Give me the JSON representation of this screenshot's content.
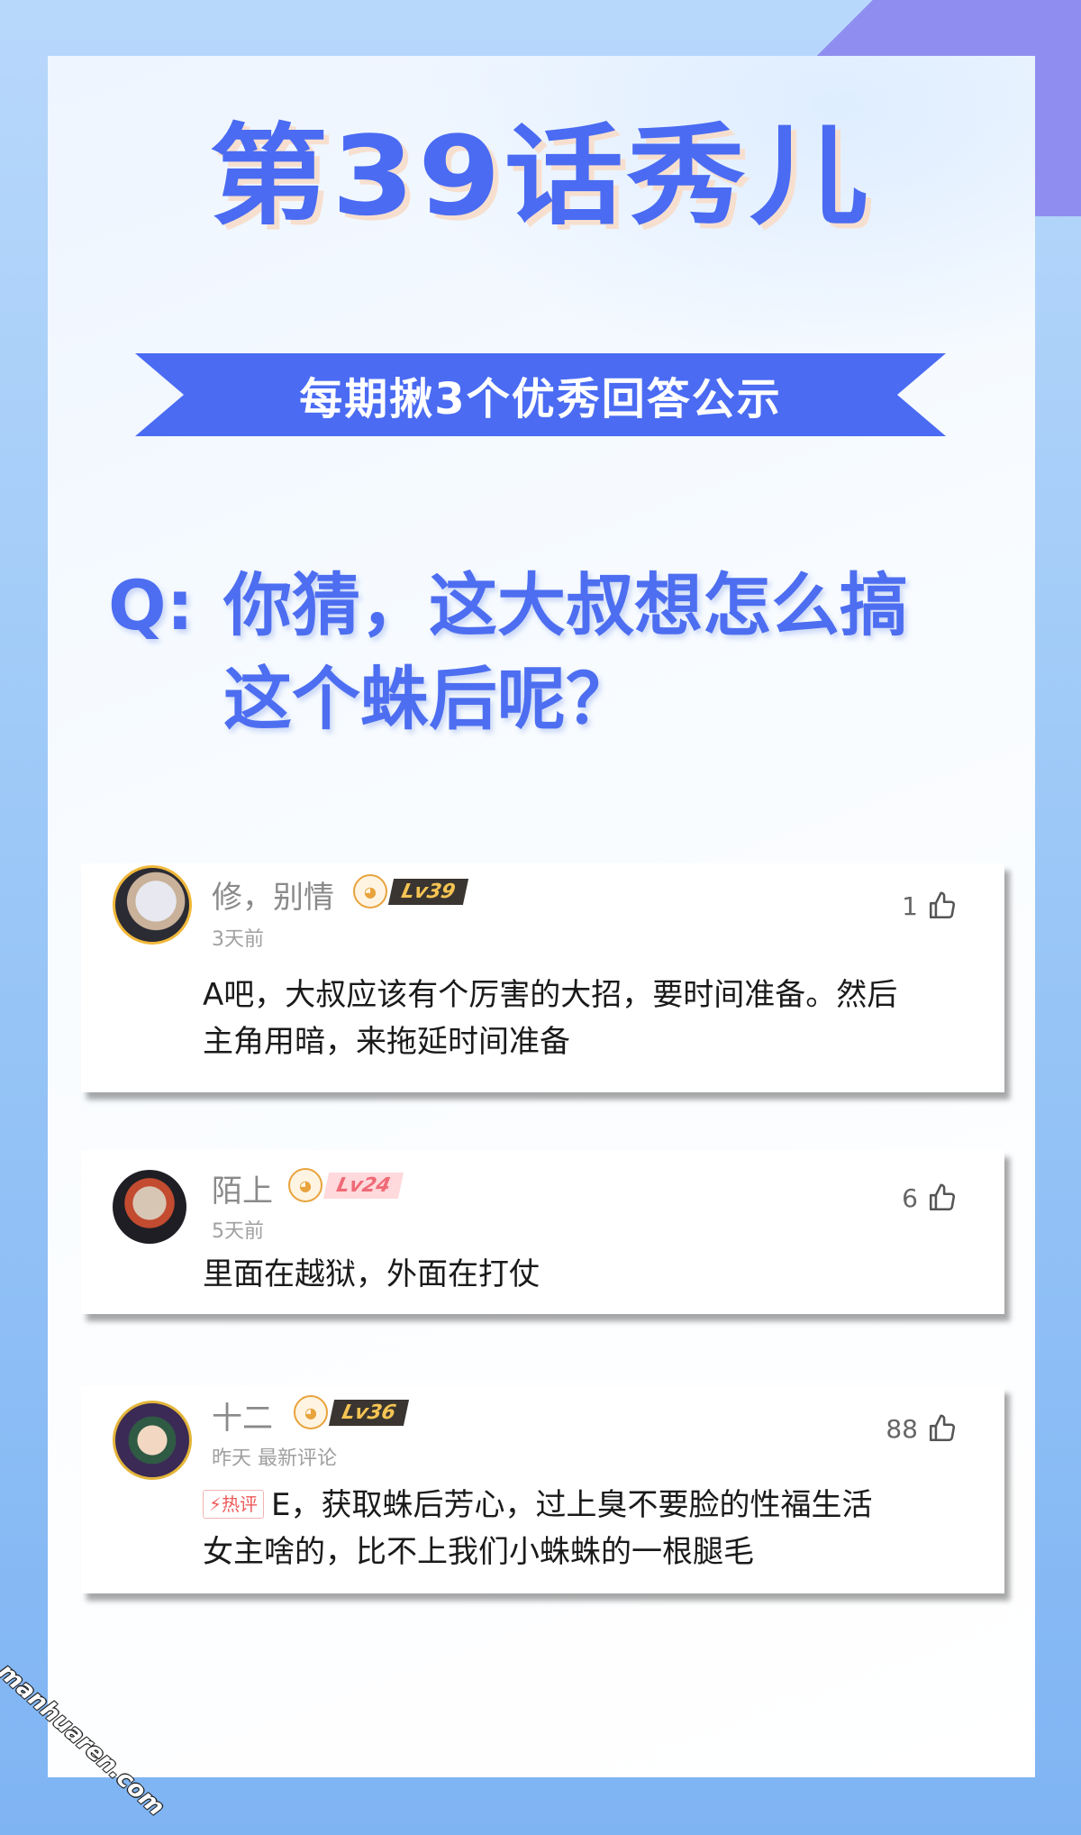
{
  "header": {
    "title": "第39话秀儿",
    "ribbon": "每期揪3个优秀回答公示"
  },
  "question": {
    "prefix": "Q:",
    "line1": "你猜，这大叔想怎么搞",
    "line2": "这个蛛后呢？"
  },
  "comments": [
    {
      "name": "修，别情",
      "level": "Lv39",
      "time": "3天前",
      "likes": "1",
      "text_line1": "A吧，大叔应该有个厉害的大招，要时间准备。然后",
      "text_line2": "主角用暗，来拖延时间准备"
    },
    {
      "name": "陌上",
      "level": "Lv24",
      "time": "5天前",
      "likes": "6",
      "text_line1": "里面在越狱，外面在打仗"
    },
    {
      "name": "十二",
      "level": "Lv36",
      "time": "昨天 最新评论",
      "likes": "88",
      "hot_tag": "热评",
      "text_line1": "E，获取蛛后芳心，过上臭不要脸的性福生活",
      "text_line2": "女主啥的，比不上我们小蛛蛛的一根腿毛"
    }
  ],
  "watermark": "manhuaren.com",
  "colors": {
    "accent": "#4a6bf2",
    "background": "#9cc8f7",
    "hot": "#ef5a5a"
  },
  "icons": [
    "thumbs-up-icon",
    "level-mascot-icon",
    "lightning-icon"
  ]
}
